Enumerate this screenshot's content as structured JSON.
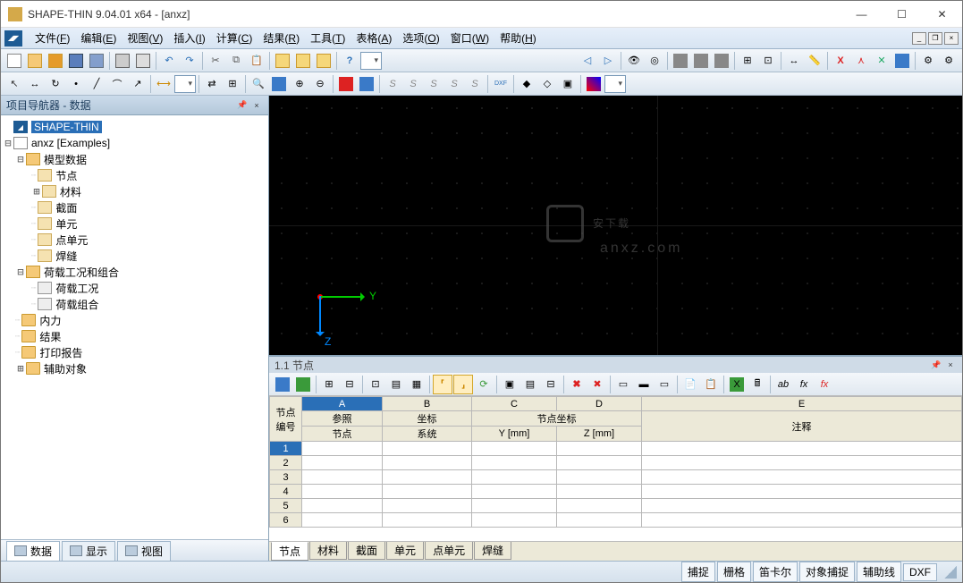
{
  "window": {
    "title": "SHAPE-THIN 9.04.01 x64 - [anxz]"
  },
  "menu": {
    "items": [
      {
        "label": "文件",
        "key": "F"
      },
      {
        "label": "编辑",
        "key": "E"
      },
      {
        "label": "视图",
        "key": "V"
      },
      {
        "label": "插入",
        "key": "I"
      },
      {
        "label": "计算",
        "key": "C"
      },
      {
        "label": "结果",
        "key": "R"
      },
      {
        "label": "工具",
        "key": "T"
      },
      {
        "label": "表格",
        "key": "A"
      },
      {
        "label": "选项",
        "key": "O"
      },
      {
        "label": "窗口",
        "key": "W"
      },
      {
        "label": "帮助",
        "key": "H"
      }
    ]
  },
  "navigator": {
    "title": "项目导航器 - 数据",
    "root": "SHAPE-THIN",
    "project": "anxz [Examples]",
    "model_data": "模型数据",
    "nodes": {
      "jd": "节点",
      "cl": "材料",
      "jm": "截面",
      "dy": "单元",
      "ddy": "点单元",
      "hf": "焊缝"
    },
    "load_group": "荷载工况和组合",
    "load_case": "荷载工况",
    "load_combo": "荷载组合",
    "internal": "内力",
    "results": "结果",
    "print": "打印报告",
    "aux": "辅助对象",
    "tabs": {
      "data": "数据",
      "display": "显示",
      "view": "视图"
    }
  },
  "viewport": {
    "y_label": "Y",
    "z_label": "Z",
    "watermark_main": "安下载",
    "watermark_sub": "anxz.com"
  },
  "table": {
    "title": "1.1 节点",
    "col_letters": [
      "A",
      "B",
      "C",
      "D",
      "E"
    ],
    "corner": "节点\n编号",
    "group_ref": "参照",
    "group_coord": "坐标",
    "group_nodecoord": "节点坐标",
    "hdr_node": "节点",
    "hdr_sys": "系统",
    "hdr_y": "Y [mm]",
    "hdr_z": "Z [mm]",
    "hdr_note": "注释",
    "rows": [
      "1",
      "2",
      "3",
      "4",
      "5",
      "6"
    ],
    "tabs": [
      "节点",
      "材料",
      "截面",
      "单元",
      "点单元",
      "焊缝"
    ]
  },
  "status": {
    "buttons": [
      "捕捉",
      "栅格",
      "笛卡尔",
      "对象捕捉",
      "辅助线",
      "DXF"
    ]
  }
}
